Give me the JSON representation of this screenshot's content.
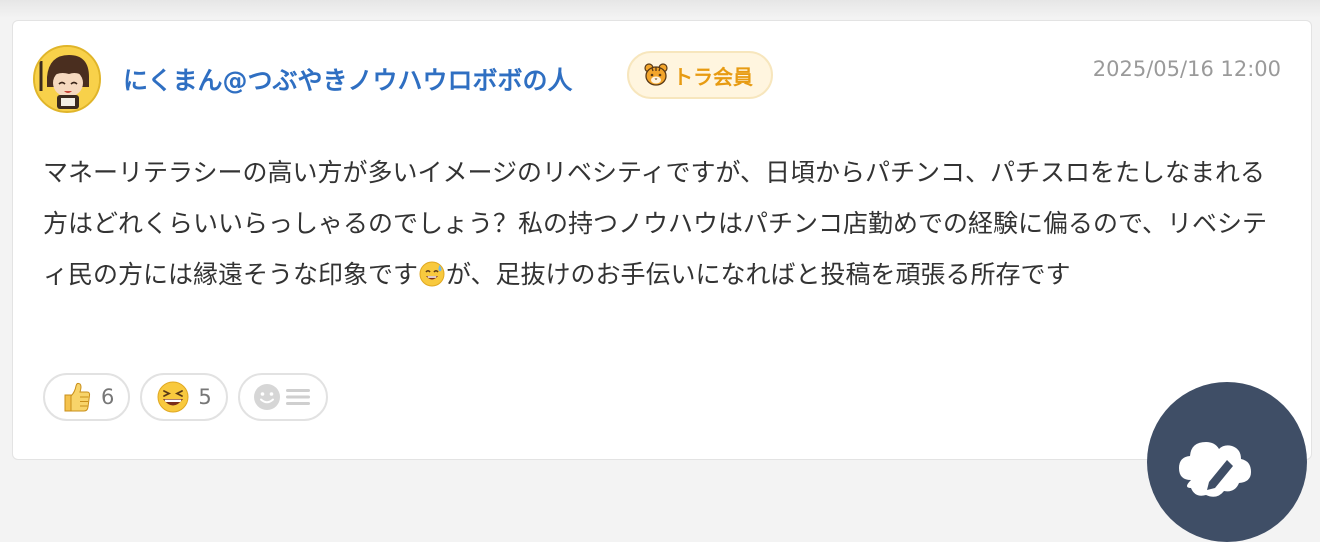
{
  "post": {
    "author": "にくまん@つぶやきノウハウロボボの人",
    "badge": {
      "label": "トラ会員",
      "icon": "tiger-icon"
    },
    "timestamp": "2025/05/16 12:00",
    "body_part1": "マネーリテラシーの高い方が多いイメージのリベシティですが、日頃からパチンコ、パチスロをたしなまれる方はどれくらいいらっしゃるのでしょう？私の持つノウハウはパチンコ店勤めでの経験に偏るので、リベシティ民の方には縁遠そうな印象です",
    "body_emoji": "sweat-smile-emoji",
    "body_part2": "が、足抜けのお手伝いになればと投稿を頑張る所存です"
  },
  "reactions": [
    {
      "icon": "thumbs-up-icon",
      "count": "6"
    },
    {
      "icon": "grinning-squint-icon",
      "count": "5"
    },
    {
      "icon": "add-reaction-icon"
    }
  ],
  "fab": {
    "icon": "pencil-icon"
  },
  "colors": {
    "author": "#2f6fc2",
    "badge_text": "#e79b12",
    "badge_bg": "#fff5df",
    "timestamp": "#9a9a9a",
    "body_text": "#333333",
    "fab_bg": "#3f4e66"
  }
}
